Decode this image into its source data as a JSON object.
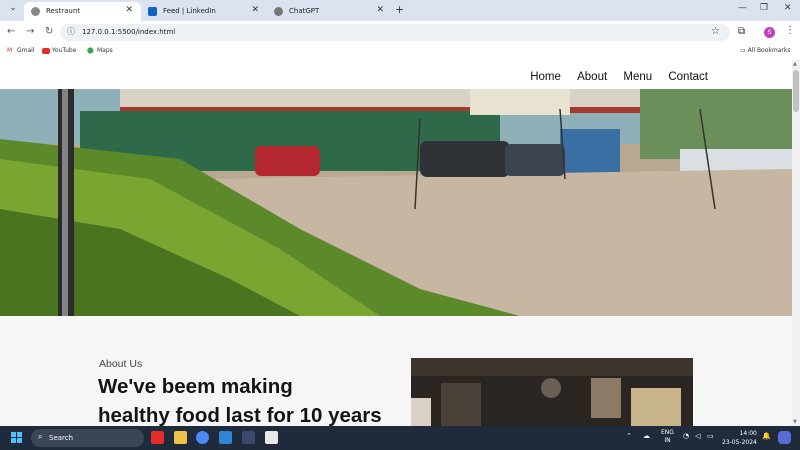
{
  "browser": {
    "tabs": [
      {
        "title": "Restraunt",
        "active": true
      },
      {
        "title": "Feed | LinkedIn",
        "active": false
      },
      {
        "title": "ChatGPT",
        "active": false
      }
    ],
    "new_tab": "+",
    "url": "127.0.0.1:5500/index.html",
    "bookmarks": [
      {
        "label": "Gmail",
        "icon": "gmail-icon"
      },
      {
        "label": "YouTube",
        "icon": "youtube-icon"
      },
      {
        "label": "Maps",
        "icon": "maps-icon"
      }
    ],
    "all_bookmarks": "All Bookmarks",
    "profile_initial": "S"
  },
  "site": {
    "nav": [
      "Home",
      "About",
      "Menu",
      "Contact"
    ],
    "hero_image": "parking-lot-photo",
    "about": {
      "label": "About Us",
      "title_line1": "We've beem making",
      "title_line2": "healthy food last for 10 years"
    },
    "about_image": "kitchen-photo"
  },
  "taskbar": {
    "search": "Search",
    "lang": "ENG",
    "region": "IN",
    "time": "14:00",
    "date": "23-05-2024"
  },
  "colors": {
    "tabbar": "#dbe3f1",
    "taskbar": "#1f2b3a",
    "accent": "#4cc2ff"
  }
}
